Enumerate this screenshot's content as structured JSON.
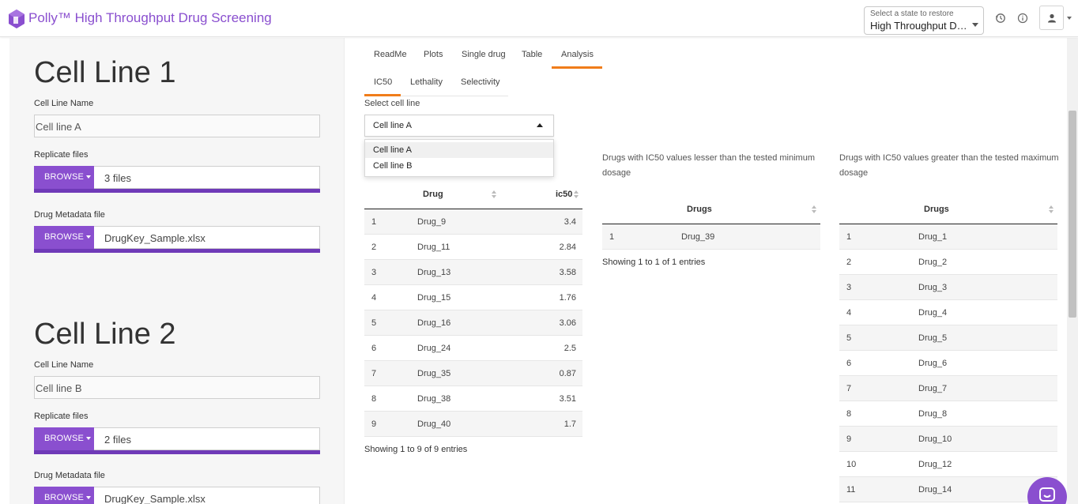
{
  "header": {
    "title": "Polly™ High Throughput Drug Screening",
    "state_label": "Select a state to restore",
    "state_value": "High Throughput Drug Screening"
  },
  "colors": {
    "brand": "#8a4fcf",
    "accent": "#f07d1a",
    "progress": "#6f3ab8"
  },
  "icons": [
    "polly-logo-icon",
    "history-icon",
    "info-icon",
    "user-icon",
    "chevron-down-icon",
    "sort-icon",
    "chat-icon"
  ],
  "sidebar": {
    "cell_lines": [
      {
        "title": "Cell Line 1",
        "name_label": "Cell Line Name",
        "name_value": "Cell line A",
        "replicate_label": "Replicate files",
        "replicate_button": "BROWSE",
        "replicate_value": "3 files",
        "metadata_label": "Drug Metadata file",
        "metadata_button": "BROWSE",
        "metadata_value": "DrugKey_Sample.xlsx"
      },
      {
        "title": "Cell Line 2",
        "name_label": "Cell Line Name",
        "name_value": "Cell line B",
        "replicate_label": "Replicate files",
        "replicate_button": "BROWSE",
        "replicate_value": "2 files",
        "metadata_label": "Drug Metadata file",
        "metadata_button": "BROWSE",
        "metadata_value": "DrugKey_Sample.xlsx"
      }
    ]
  },
  "tabs": [
    "ReadMe",
    "Plots",
    "Single drug",
    "Table",
    "Analysis"
  ],
  "active_tab": "Analysis",
  "subtabs": [
    "IC50",
    "Lethality",
    "Selectivity"
  ],
  "active_subtab": "IC50",
  "select": {
    "label": "Select cell line",
    "value": "Cell line A",
    "options": [
      "Cell line A",
      "Cell line B"
    ]
  },
  "ic50_table": {
    "headers": [
      "",
      "Drug",
      "ic50"
    ],
    "rows": [
      [
        "1",
        "Drug_9",
        "3.4"
      ],
      [
        "2",
        "Drug_11",
        "2.84"
      ],
      [
        "3",
        "Drug_13",
        "3.58"
      ],
      [
        "4",
        "Drug_15",
        "1.76"
      ],
      [
        "5",
        "Drug_16",
        "3.06"
      ],
      [
        "6",
        "Drug_24",
        "2.5"
      ],
      [
        "7",
        "Drug_35",
        "0.87"
      ],
      [
        "8",
        "Drug_38",
        "3.51"
      ],
      [
        "9",
        "Drug_40",
        "1.7"
      ]
    ],
    "footer": "Showing 1 to 9 of 9 entries"
  },
  "lesser_table": {
    "description": "Drugs with IC50 values lesser than the tested minimum dosage",
    "headers": [
      "",
      "Drugs"
    ],
    "rows": [
      [
        "1",
        "Drug_39"
      ]
    ],
    "footer": "Showing 1 to 1 of 1 entries"
  },
  "greater_table": {
    "description": "Drugs with IC50 values greater than the tested maximum dosage",
    "headers": [
      "",
      "Drugs"
    ],
    "rows": [
      [
        "1",
        "Drug_1"
      ],
      [
        "2",
        "Drug_2"
      ],
      [
        "3",
        "Drug_3"
      ],
      [
        "4",
        "Drug_4"
      ],
      [
        "5",
        "Drug_5"
      ],
      [
        "6",
        "Drug_6"
      ],
      [
        "7",
        "Drug_7"
      ],
      [
        "8",
        "Drug_8"
      ],
      [
        "9",
        "Drug_10"
      ],
      [
        "10",
        "Drug_12"
      ],
      [
        "11",
        "Drug_14"
      ]
    ]
  }
}
